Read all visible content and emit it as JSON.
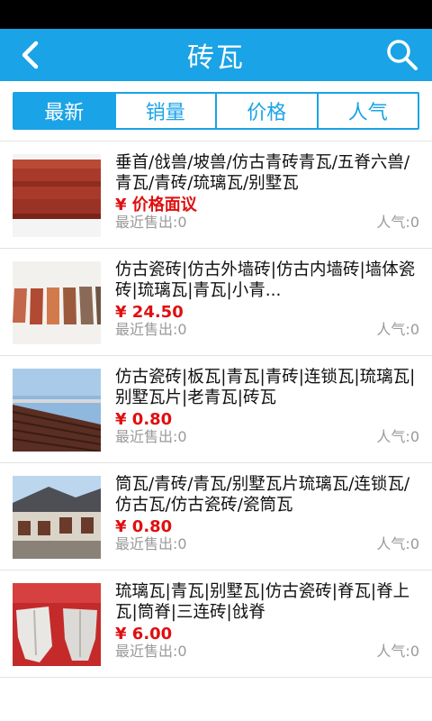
{
  "header": {
    "title": "砖瓦",
    "back_icon": "back-arrow-icon",
    "search_icon": "search-icon",
    "color": "#1aa3e6"
  },
  "tabs": [
    {
      "label": "最新",
      "active": true
    },
    {
      "label": "销量",
      "active": false
    },
    {
      "label": "价格",
      "active": false
    },
    {
      "label": "人气",
      "active": false
    }
  ],
  "products": [
    {
      "name": "垂首/戗兽/坡兽/仿古青砖青瓦/五脊六兽/青瓦/青砖/琉璃瓦/别墅瓦",
      "price": "¥ 价格面议",
      "sold": "最近售出:0",
      "popularity": "人气:0"
    },
    {
      "name": "仿古瓷砖|仿古外墙砖|仿古内墙砖|墙体瓷砖|琉璃瓦|青瓦|小青...",
      "price": "¥ 24.50",
      "sold": "最近售出:0",
      "popularity": "人气:0"
    },
    {
      "name": "仿古瓷砖|板瓦|青瓦|青砖|连锁瓦|琉璃瓦|别墅瓦片|老青瓦|砖瓦",
      "price": "¥ 0.80",
      "sold": "最近售出:0",
      "popularity": "人气:0"
    },
    {
      "name": "筒瓦/青砖/青瓦/别墅瓦片琉璃瓦/连锁瓦/仿古瓦/仿古瓷砖/瓷筒瓦",
      "price": "¥ 0.80",
      "sold": "最近售出:0",
      "popularity": "人气:0"
    },
    {
      "name": "琉璃瓦|青瓦|别墅瓦|仿古瓷砖|脊瓦|脊上瓦|筒脊|三连砖|戗脊",
      "price": "¥ 6.00",
      "sold": "最近售出:0",
      "popularity": "人气:0"
    }
  ]
}
